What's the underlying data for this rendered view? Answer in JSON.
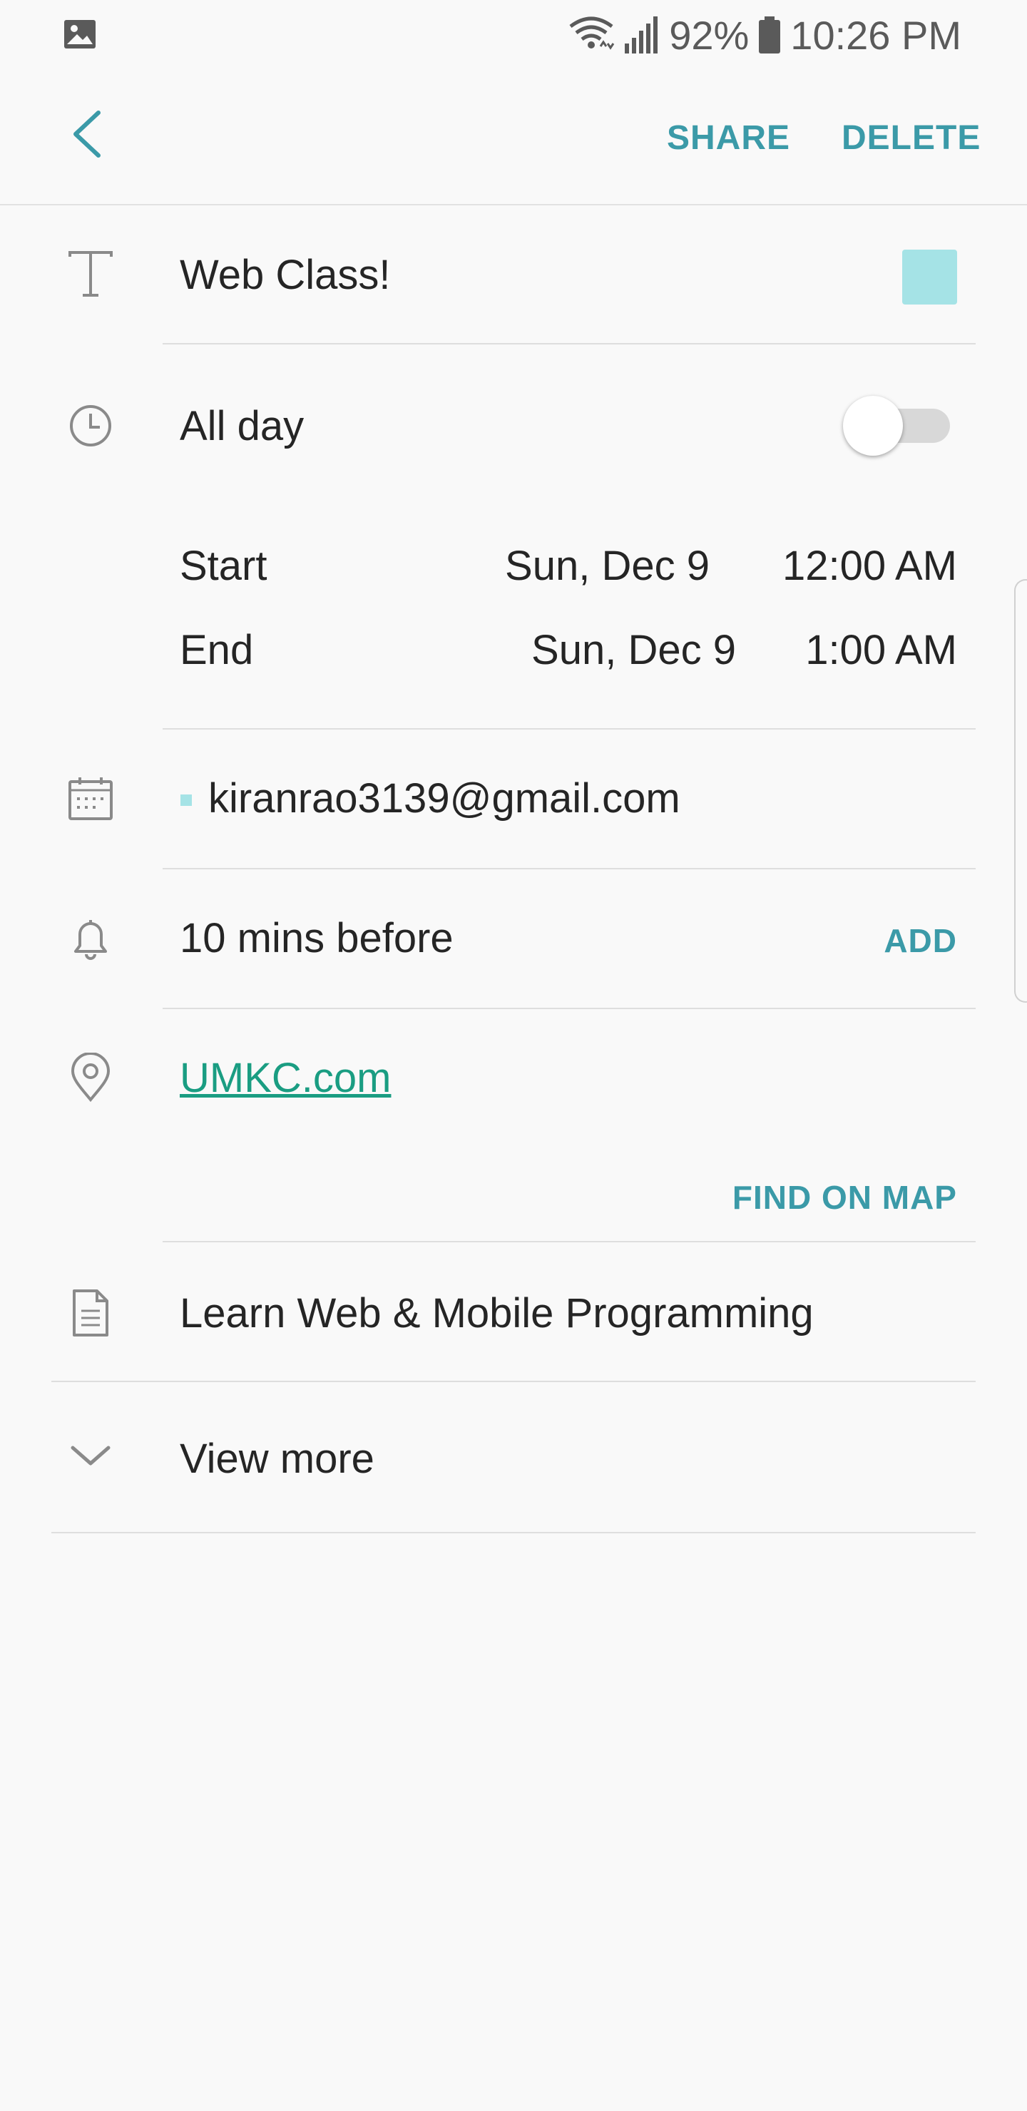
{
  "status_bar": {
    "battery": "92%",
    "time": "10:26 PM"
  },
  "toolbar": {
    "share_label": "SHARE",
    "delete_label": "DELETE"
  },
  "event": {
    "title": "Web Class!",
    "color": "#a5e3e6",
    "all_day_label": "All day",
    "all_day_enabled": false,
    "start_label": "Start",
    "start_date": "Sun, Dec 9",
    "start_time": "12:00 AM",
    "end_label": "End",
    "end_date": "Sun, Dec 9",
    "end_time": "1:00 AM",
    "calendar_account": "kiranrao3139@gmail.com",
    "reminder": "10 mins before",
    "add_reminder_label": "ADD",
    "location": "UMKC.com",
    "find_on_map_label": "FIND ON MAP",
    "description": "Learn Web & Mobile Programming",
    "view_more_label": "View more"
  },
  "colors": {
    "accent": "#3b9aa8",
    "link": "#1a9d82",
    "background": "#f9f9f9"
  }
}
